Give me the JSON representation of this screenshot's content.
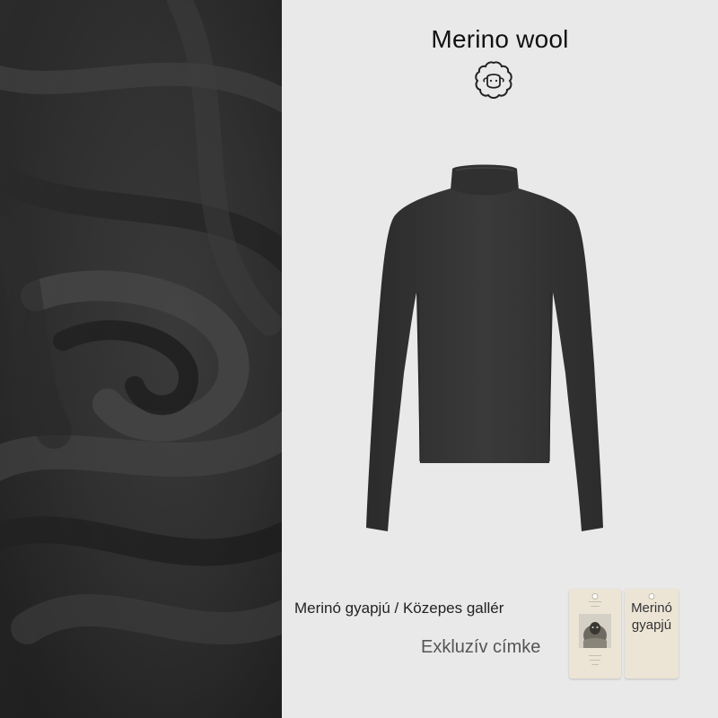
{
  "title": "Merino wool",
  "icons": {
    "sheep": "sheep-icon"
  },
  "caption": {
    "line1": "Merinó gyapjú / Közepes gallér",
    "line2": "Exkluzív címke"
  },
  "tag2": {
    "line1": "Merinó",
    "line2": "gyapjú"
  },
  "colors": {
    "fabric": "#2c2c2c",
    "sweater": "#333333",
    "background": "#e9e9e9",
    "tag": "#ece5d6"
  }
}
